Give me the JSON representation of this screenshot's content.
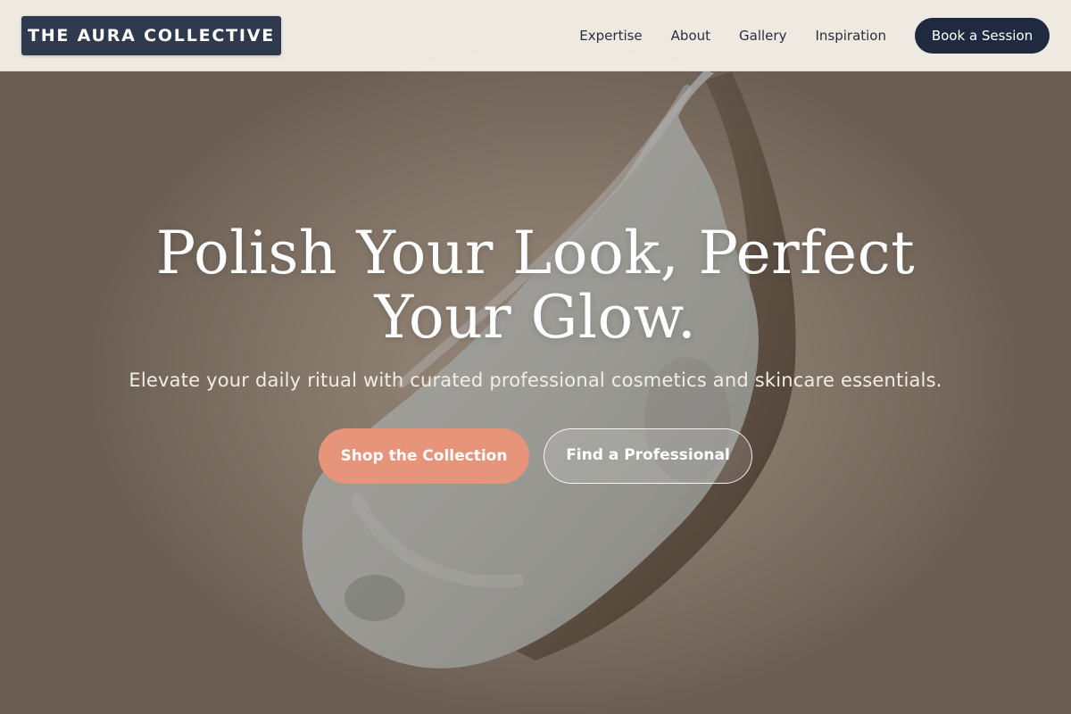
{
  "header": {
    "logo_text": "THE AURA COLLECTIVE",
    "nav": [
      {
        "label": "Expertise"
      },
      {
        "label": "About"
      },
      {
        "label": "Gallery"
      },
      {
        "label": "Inspiration"
      }
    ],
    "cta_label": "Book a Session"
  },
  "hero": {
    "title": "Polish Your Look, Perfect Your Glow.",
    "subtitle": "Elevate your daily ritual with curated professional cosmetics and skincare essentials.",
    "primary_button": "Shop the Collection",
    "secondary_button": "Find a Professional",
    "background_image": "cream-swatch-smear"
  },
  "colors": {
    "header_bg": "#f5f1ea",
    "logo_bg": "#2f3a4f",
    "cta_bg": "#1f2a40",
    "primary_button": "#e6957a",
    "nav_text": "#2a2f3a"
  }
}
